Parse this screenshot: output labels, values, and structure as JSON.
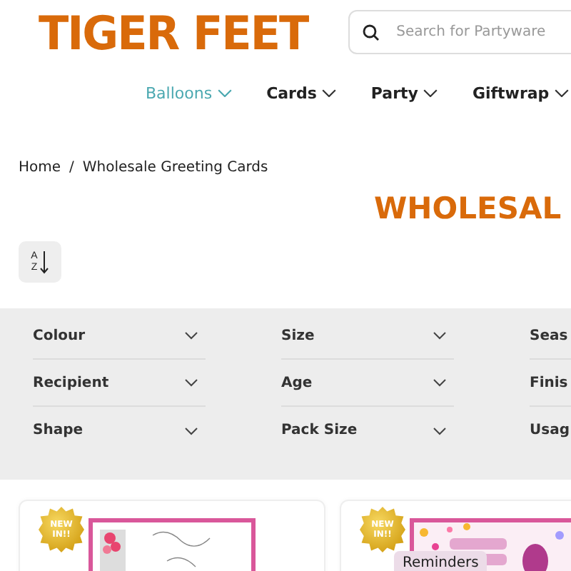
{
  "header": {
    "logo": "TIGER FEET",
    "search": {
      "placeholder": "Search for Partyware"
    }
  },
  "nav": [
    {
      "label": "Balloons",
      "selected": true
    },
    {
      "label": "Cards",
      "selected": false
    },
    {
      "label": "Party",
      "selected": false
    },
    {
      "label": "Giftwrap",
      "selected": false
    }
  ],
  "breadcrumb": [
    "Home",
    "/",
    "Wholesale Greeting Cards"
  ],
  "heading": "WHOLESAL",
  "sort_button": {
    "top": "A",
    "bottom": "Z"
  },
  "filters": [
    [
      "Colour",
      "Recipient",
      "Shape"
    ],
    [
      "Size",
      "Age",
      "Pack Size"
    ],
    [
      "Seas",
      "Finis",
      "Usag"
    ]
  ],
  "products": [
    {
      "badge": "NEW IN!!",
      "kind": "picture"
    },
    {
      "badge": "NEW IN!!",
      "kind": "picture"
    }
  ],
  "reminders_button": "Reminders"
}
